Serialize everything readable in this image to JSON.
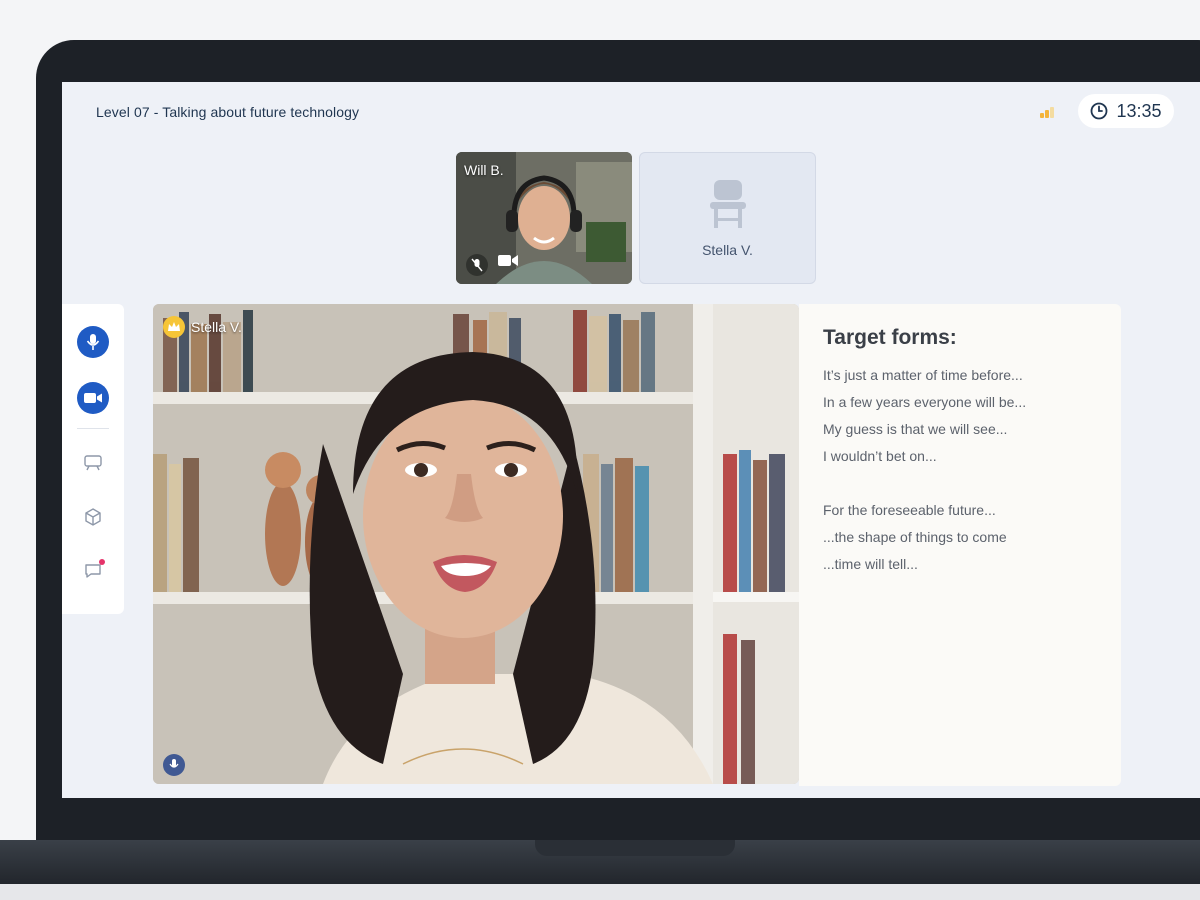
{
  "header": {
    "lesson_title": "Level 07 - Talking about future technology",
    "timer": "13:35"
  },
  "participants": {
    "will": {
      "name": "Will B."
    },
    "stella_seat": {
      "name": "Stella V."
    },
    "main_speaker": {
      "name": "Stella V."
    }
  },
  "sidebar": {
    "items": [
      "mic-icon",
      "camera-icon",
      "whiteboard-icon",
      "cube-icon",
      "chat-icon"
    ]
  },
  "target_forms": {
    "title": "Target forms:",
    "group1": [
      "It’s just a matter of time before...",
      "In a few years everyone will be...",
      "My guess is that we will see...",
      "I wouldn’t bet on..."
    ],
    "group2": [
      "For the foreseeable future...",
      "...the shape of things to come",
      "...time will tell..."
    ]
  },
  "colors": {
    "accent_blue": "#1f5bc4",
    "signal": "#f4b43a",
    "notification": "#e5336a",
    "crown": "#f6c537"
  }
}
